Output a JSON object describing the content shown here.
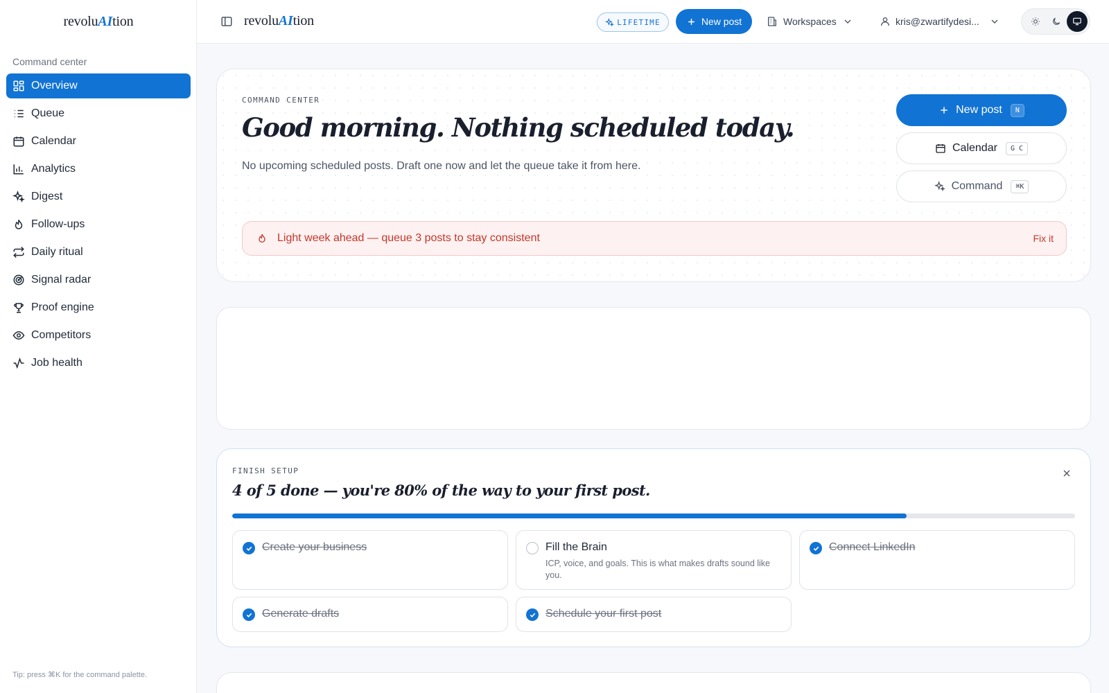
{
  "brand": {
    "prefix": "revolu",
    "ai": "AI",
    "suffix": "tion"
  },
  "sidebar": {
    "section_label": "Command center",
    "items": [
      {
        "label": "Overview",
        "icon": "grid-icon",
        "active": true
      },
      {
        "label": "Queue",
        "icon": "list-icon"
      },
      {
        "label": "Calendar",
        "icon": "calendar-icon"
      },
      {
        "label": "Analytics",
        "icon": "bar-chart-icon"
      },
      {
        "label": "Digest",
        "icon": "sparkles-icon"
      },
      {
        "label": "Follow-ups",
        "icon": "flame-icon"
      },
      {
        "label": "Daily ritual",
        "icon": "repeat-icon"
      },
      {
        "label": "Signal radar",
        "icon": "radar-icon"
      },
      {
        "label": "Proof engine",
        "icon": "trophy-icon"
      },
      {
        "label": "Competitors",
        "icon": "eye-icon"
      },
      {
        "label": "Job health",
        "icon": "activity-icon"
      }
    ],
    "tip": "Tip: press ⌘K for the command palette."
  },
  "topbar": {
    "plan_badge": "LIFETIME",
    "new_post_label": "New post",
    "workspaces_label": "Workspaces",
    "account_label": "kris@zwartifydesi...",
    "theme_options": [
      "sun-icon",
      "moon-icon",
      "monitor-icon"
    ],
    "theme_active": "monitor-icon"
  },
  "hero": {
    "eyebrow": "COMMAND CENTER",
    "title": "Good morning. Nothing scheduled today.",
    "subtitle": "No upcoming scheduled posts. Draft one now and let the queue take it from here.",
    "actions": [
      {
        "label": "New post",
        "shortcut": "N",
        "style": "primary",
        "icon": "plus-icon"
      },
      {
        "label": "Calendar",
        "shortcut": "G C",
        "style": "outline",
        "icon": "calendar-icon"
      },
      {
        "label": "Command",
        "shortcut": "⌘K",
        "style": "muted",
        "icon": "sparkles-icon"
      }
    ],
    "alert": {
      "text": "Light week ahead — queue 3 posts to stay consistent",
      "action": "Fix it"
    }
  },
  "setup": {
    "eyebrow": "FINISH SETUP",
    "title": "4 of 5 done — you're 80% of the way to your first post.",
    "progress": 0.8,
    "tasks": [
      {
        "title": "Create your business",
        "done": true
      },
      {
        "title": "Fill the Brain",
        "done": false,
        "desc": "ICP, voice, and goals. This is what makes drafts sound like you."
      },
      {
        "title": "Connect LinkedIn",
        "done": true
      },
      {
        "title": "Generate drafts",
        "done": true
      },
      {
        "title": "Schedule your first post",
        "done": true
      }
    ]
  },
  "colors": {
    "accent": "#1173d4",
    "alert_text": "#c0392b",
    "alert_bg": "#fdf1f1"
  }
}
